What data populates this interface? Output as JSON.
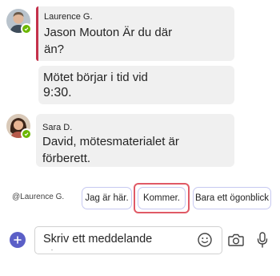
{
  "conversation": {
    "messages": [
      {
        "sender": "Laurence G.",
        "text_line1": "Jason Mouton Är du där",
        "text_line2": "än?",
        "important": true
      },
      {
        "text_line1": "Mötet börjar i tid vid",
        "text_line2": "9:30."
      },
      {
        "sender": "Sara D.",
        "text_line1": "David, mötesmaterialet är",
        "text_line2": "förberett."
      }
    ]
  },
  "suggestions": {
    "mention": "@Laurence G.",
    "replies": [
      "Jag är här.",
      "Kommer.",
      "Bara ett ögonblick"
    ],
    "highlighted_index": 1
  },
  "compose": {
    "placeholder": "Skriv ett meddelande"
  },
  "colors": {
    "accent": "#5b5fc7",
    "presence_available": "#6bb700",
    "important_bar": "#c4314b",
    "highlight_outline": "#e05a66",
    "bubble_bg": "#f0f0f0"
  },
  "icons": {
    "add": "plus-icon",
    "emoji": "emoji-icon",
    "camera": "camera-icon",
    "microphone": "microphone-icon",
    "presence": "checkmark-icon"
  }
}
